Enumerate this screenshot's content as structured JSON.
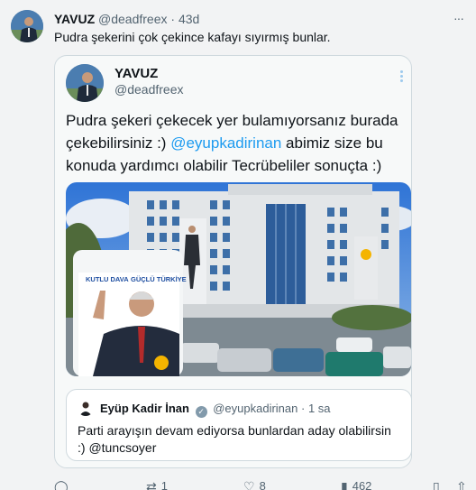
{
  "tweet": {
    "author_name": "YAVUZ",
    "author_handle": "@deadfreex",
    "time": "43d",
    "text": "Pudra şekerini çok çekince kafayı sıyırmış bunlar.",
    "menu": "···"
  },
  "card": {
    "author_name": "YAVUZ",
    "author_handle": "@deadfreex",
    "text_before": "Pudra şekeri çekecek yer bulamıyorsanız burada çekebilirsiniz :) ",
    "mention": "@eyupkadirinan",
    "text_after": " abimiz size bu konuda yardımcı olabilir Tecrübeliler sonuçta :)",
    "photo": {
      "banner_line1": "KUTLU DAVA",
      "banner_line2": "GÜÇLÜ TÜRKİYE"
    }
  },
  "quote": {
    "author_name": "Eyüp Kadir İnan",
    "verified_mark": "✓",
    "author_handle": "@eyupkadirinan",
    "time": "· 1 sa",
    "text": "Parti arayışın devam ediyorsa bunlardan aday olabilirsin :) @tuncsoyer"
  },
  "actions": {
    "reply_icon": "speech-bubble-icon",
    "retweet_count": "1",
    "like_count": "8",
    "views_count": "462"
  },
  "colors": {
    "background": "#f2f3f4",
    "card_background": "#f7f9f9",
    "border": "#cfd9de",
    "link": "#1d9bf0",
    "muted": "#536471"
  }
}
